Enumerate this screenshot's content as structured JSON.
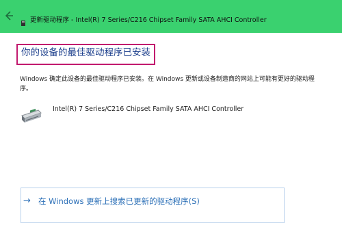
{
  "window": {
    "title": "更新驱动程序 - Intel(R) 7 Series/C216 Chipset Family SATA AHCI Controller",
    "back_icon": "back-arrow-icon",
    "titlebar_color": "#3ad16f"
  },
  "main": {
    "heading": "你的设备的最佳驱动程序已安装",
    "heading_highlight_color": "#c2196e",
    "description": "Windows 确定此设备的最佳驱动程序已安装。在 Windows 更新或设备制造商的网站上可能有更好的驱动程序。",
    "device": {
      "icon": "storage-controller-icon",
      "name": "Intel(R) 7 Series/C216 Chipset Family SATA AHCI Controller"
    },
    "search_option": {
      "arrow": "→",
      "label": "在 Windows 更新上搜索已更新的驱动程序(S)",
      "link_color": "#2b6fb7"
    }
  }
}
